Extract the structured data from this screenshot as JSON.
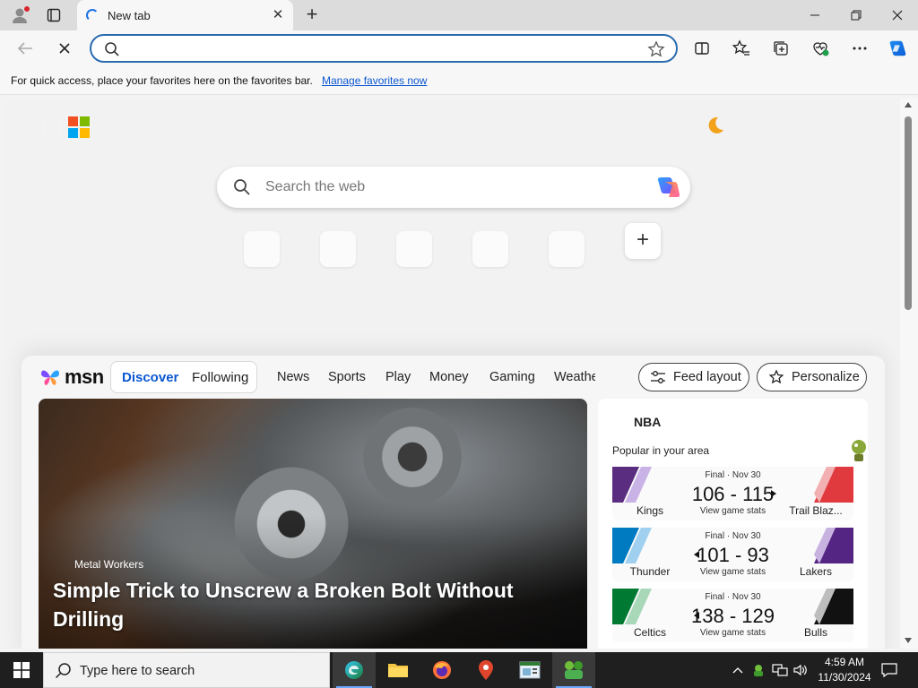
{
  "browser": {
    "tab_title": "New tab",
    "address_value": "",
    "favorites_message": "For quick access, place your favorites here on the favorites bar.",
    "favorites_link": "Manage favorites now"
  },
  "newtab": {
    "search_placeholder": "Search the web"
  },
  "msn": {
    "logo_text": "msn",
    "tabs": {
      "discover": "Discover",
      "following": "Following"
    },
    "nav": [
      "News",
      "Sports",
      "Play",
      "Money",
      "Gaming",
      "Weathe"
    ],
    "feed_layout_label": "Feed layout",
    "personalize_label": "Personalize",
    "hero": {
      "category": "Metal Workers",
      "title": "Simple Trick to Unscrew a Broken Bolt Without Drilling"
    },
    "sports": {
      "league": "NBA",
      "subtitle": "Popular in your area",
      "games": [
        {
          "status": "Final · Nov 30",
          "home": "Kings",
          "away": "Trail Blaz...",
          "score": "106 - 115",
          "winner": "right",
          "stats": "View game stats",
          "left_color": "#5a2d81",
          "right_color": "#e03a3e"
        },
        {
          "status": "Final · Nov 30",
          "home": "Thunder",
          "away": "Lakers",
          "score": "101 - 93",
          "winner": "left",
          "stats": "View game stats",
          "left_color": "#007ac1",
          "right_color": "#552583"
        },
        {
          "status": "Final · Nov 30",
          "home": "Celtics",
          "away": "Bulls",
          "score": "138 - 129",
          "winner": "left",
          "stats": "View game stats",
          "left_color": "#007a33",
          "right_color": "#111111"
        }
      ]
    }
  },
  "taskbar": {
    "search_text": "Type here to search",
    "time": "4:59 AM",
    "date": "11/30/2024"
  },
  "colors": {
    "accent": "#0b57d0",
    "address_border": "#2b6cb0",
    "taskbar": "#1f1f1f"
  }
}
